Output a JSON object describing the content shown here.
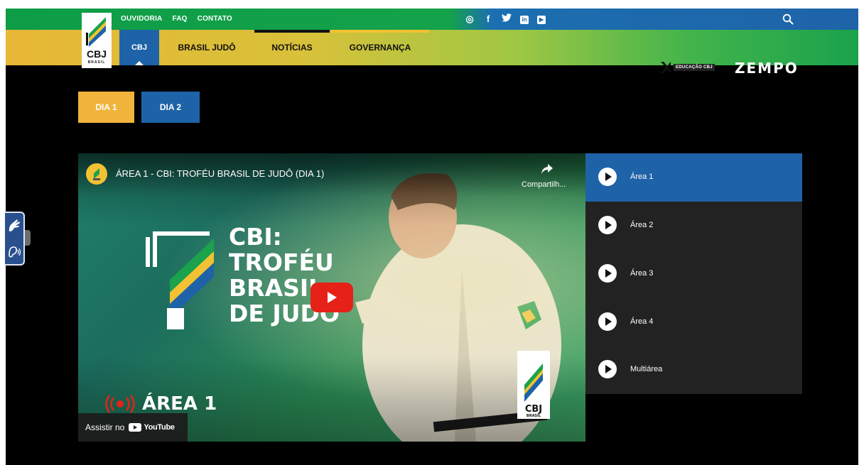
{
  "utility_links": [
    "OUVIDORIA",
    "FAQ",
    "CONTATO"
  ],
  "social_icons": [
    {
      "name": "instagram-icon",
      "glyph": "◎"
    },
    {
      "name": "facebook-icon",
      "glyph": "f"
    },
    {
      "name": "twitter-icon",
      "glyph": "🐦"
    },
    {
      "name": "linkedin-icon",
      "glyph": "in"
    },
    {
      "name": "youtube-icon",
      "glyph": "▶"
    }
  ],
  "logo": {
    "text": "CBJ",
    "subtext": "BRASIL"
  },
  "nav": {
    "cbj": "CBJ",
    "brasil_judo": "BRASIL JUDÔ",
    "noticias": "NOTÍCIAS",
    "governanca": "GOVERNANÇA"
  },
  "partners": {
    "educacao": "EDUCAÇÃO CBJ",
    "zempo": "ZEMPO"
  },
  "day_tabs": {
    "day1": "DIA 1",
    "day2": "DIA 2",
    "active": "DIA 1"
  },
  "video": {
    "title": "ÁREA 1 - CBI: TROFÉU BRASIL DE JUDÔ (DIA 1)",
    "share_label": "Compartilh...",
    "event_lines": [
      "CBI:",
      "TROFÉU",
      "BRASIL",
      "DE JUDÔ"
    ],
    "area_badge": "ÁREA 1",
    "watch_on": "Assistir no",
    "youtube_text": "YouTube",
    "mini_logo_text": "CBJ",
    "mini_logo_sub": "BRASIL"
  },
  "playlist": {
    "active_index": 0,
    "items": [
      "Área 1",
      "Área 2",
      "Área 3",
      "Área 4",
      "Multiárea"
    ]
  },
  "colors": {
    "blue": "#1e63a8",
    "green": "#0e9d47",
    "yellow": "#f0b43c",
    "youtube_red": "#e62117"
  }
}
